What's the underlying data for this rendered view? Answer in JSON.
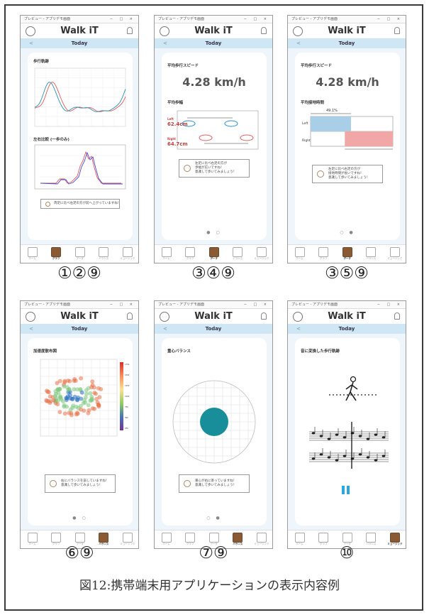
{
  "window_title": "プレビュー - アプリデモ画面",
  "window_controls": "− □ ×",
  "app_title": "Walk iT",
  "date_label": "Today",
  "back_label": "<",
  "nav_items": [
    "ホーム",
    "グラフ",
    "データ",
    "バランス",
    "ミュージック"
  ],
  "panels": [
    {
      "caption": "①②⑨",
      "active_nav": 1,
      "sections": [
        "歩行軌跡",
        "左右比較 (一歩のみ)"
      ],
      "message": "両足に比べ左足の方が前へ上がっていますね！",
      "colors": {
        "series_a": "#e05a5a",
        "series_b": "#2a8fb0",
        "series_c": "#4a4ad0"
      }
    },
    {
      "caption": "③④⑨",
      "active_nav": 2,
      "sections": [
        "平均歩行スピード",
        "平均歩幅"
      ],
      "value": "4.28 km/h",
      "left_label": "Left",
      "left_value": "62.4cm",
      "right_label": "Right",
      "right_value": "64.7cm",
      "message": "左足に比べ右足の方が\n歩幅が広いですね！\n意識して歩いてみましょう！",
      "dots": "● ○",
      "colors": {
        "left": "#2a8fd0",
        "right": "#e06060",
        "value_text": "#c04040"
      }
    },
    {
      "caption": "③⑤⑨",
      "active_nav": 2,
      "sections": [
        "平均歩行スピード",
        "平均接地時間"
      ],
      "value": "4.28 km/h",
      "left_label": "Left",
      "right_label": "Right",
      "left_pct": "49.1%",
      "right_pct": "58.4%",
      "left_frac": 0.491,
      "right_frac": 0.584,
      "message": "左足に比べ右足の方が\n接地時間が長いですね！\n意識して歩いてみましょう！",
      "dots": "○ ●",
      "colors": {
        "left": "#a9cfe8",
        "right": "#f2a7a7"
      }
    },
    {
      "caption": "⑥⑨",
      "active_nav": 3,
      "sections": [
        "加速度散布図"
      ],
      "scale_ticks": [
        "1750",
        "1500",
        "1250",
        "1000",
        "750",
        "500",
        "250"
      ],
      "message": "右にバランスを崩していますね！\n意識して歩いてみましょう！",
      "dots": "● ○",
      "colors": {
        "center": "#2a6fc0",
        "mid": "#7fc97f",
        "outer": "#e8734a"
      }
    },
    {
      "caption": "⑦⑨",
      "active_nav": 3,
      "sections": [
        "重心バランス"
      ],
      "message": "重心が右に寄っていますね！\n意識して歩いてみましょう！",
      "dots": "○ ●",
      "colors": {
        "disk": "#178e9a"
      }
    },
    {
      "caption": "⑩",
      "active_nav": 4,
      "sections": [
        "音に変換した歩行軌跡"
      ],
      "colors": {
        "pause": "#29a8e0"
      }
    }
  ],
  "figure_caption": "図12:携帯端末用アプリケーションの表示内容例"
}
